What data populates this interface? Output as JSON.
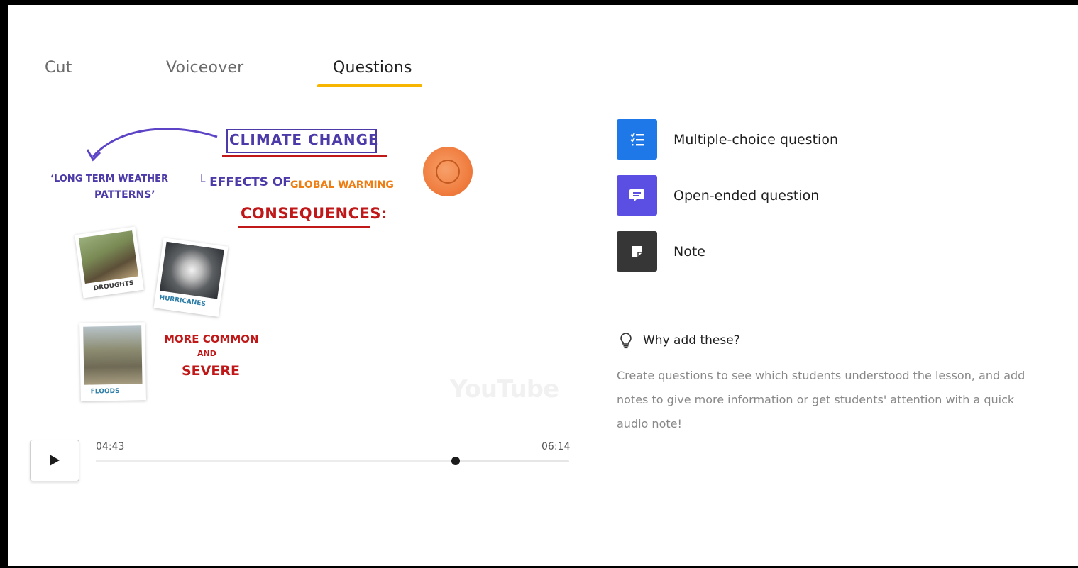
{
  "tabs": [
    {
      "label": "Cut"
    },
    {
      "label": "Voiceover"
    },
    {
      "label": "Questions"
    }
  ],
  "video": {
    "title": "CLIMATE CHANGE",
    "definition_line1": "‘LONG TERM WEATHER",
    "definition_line2": "PATTERNS’",
    "effects_prefix": "└ EFFECTS OF",
    "effects_highlight": "GLOBAL WARMING",
    "consequences": "CONSEQUENCES:",
    "photo_captions": [
      "DROUGHTS",
      "HURRICANES",
      "FLOODS"
    ],
    "more_common": "MORE COMMON",
    "and": "AND",
    "severe": "SEVERE",
    "watermark": "YouTube"
  },
  "player": {
    "current_time": "04:43",
    "total_time": "06:14",
    "progress": 0.76
  },
  "options": [
    {
      "label": "Multiple-choice question",
      "icon": "list-check-icon",
      "color": "#1f78e8"
    },
    {
      "label": "Open-ended question",
      "icon": "speech-bubble-icon",
      "color": "#5b4ee3"
    },
    {
      "label": "Note",
      "icon": "note-icon",
      "color": "#363636"
    }
  ],
  "why": {
    "title": "Why add these?",
    "description": "Create questions to see which students understood the lesson, and add notes to give more information or get students' attention with a quick audio note!"
  },
  "colors": {
    "tab_underline": "#f7b500"
  }
}
